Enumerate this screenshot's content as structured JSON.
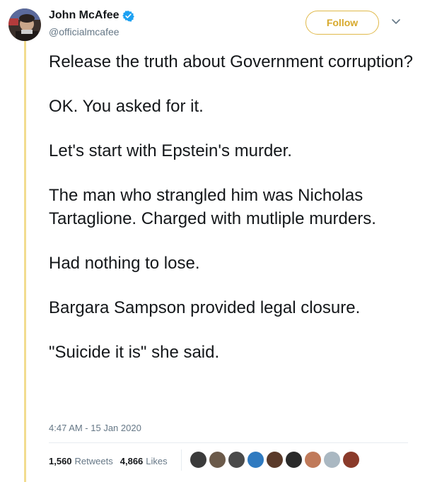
{
  "author": {
    "name": "John McAfee",
    "handle": "@officialmcafee",
    "verified": true
  },
  "follow_button": {
    "label": "Follow"
  },
  "tweet": {
    "paragraphs": [
      "Release the truth about Government corruption?",
      "OK. You asked for it.",
      "Let's start with Epstein's murder.",
      "The man who strangled him was Nicholas Tartaglione. Charged with mutliple murders.",
      "Had nothing to lose.",
      "Bargara Sampson provided legal closure.",
      "\"Suicide it is\" she said."
    ],
    "timestamp": "4:47 AM - 15 Jan 2020"
  },
  "stats": {
    "retweets_count": "1,560",
    "retweets_label": "Retweets",
    "likes_count": "4,866",
    "likes_label": "Likes"
  },
  "likers": [
    {
      "icon": "liker-avatar",
      "color": "#3b3b3b"
    },
    {
      "icon": "liker-avatar",
      "color": "#6b5a4a"
    },
    {
      "icon": "liker-avatar",
      "color": "#4a4a4a"
    },
    {
      "icon": "liker-avatar",
      "color": "#2f7ac0"
    },
    {
      "icon": "liker-avatar",
      "color": "#5a3a2a"
    },
    {
      "icon": "liker-avatar",
      "color": "#2a2a2a"
    },
    {
      "icon": "liker-avatar",
      "color": "#c07a5a"
    },
    {
      "icon": "default-avatar",
      "color": "#aab8c2"
    },
    {
      "icon": "liker-avatar",
      "color": "#8a3a2a"
    }
  ],
  "colors": {
    "thread_line": "#f2dc8f",
    "follow_accent": "#e0b94a",
    "secondary_text": "#657786",
    "verified_badge": "#1da1f2"
  }
}
